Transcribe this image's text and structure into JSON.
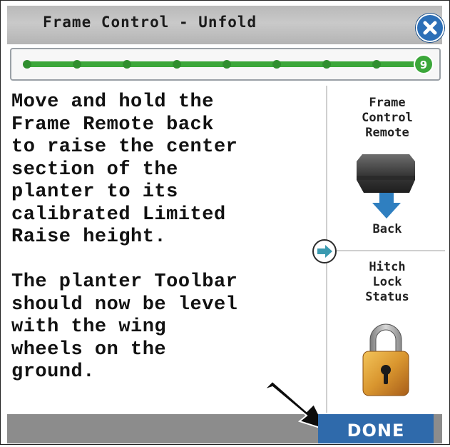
{
  "header": {
    "title": "Frame Control - Unfold"
  },
  "progress": {
    "total_steps": 9,
    "current_step": "9"
  },
  "instructions": {
    "text": "Move and hold the\nFrame Remote back\nto raise the center\nsection of the\nplanter to its\ncalibrated Limited\nRaise height.\n\nThe planter Toolbar\nshould now be level\nwith the wing\nwheels on the\nground."
  },
  "remote_panel": {
    "title": "Frame\nControl\nRemote",
    "direction_label": "Back"
  },
  "hitch_panel": {
    "title": "Hitch\nLock\nStatus",
    "status_icon": "padlock-locked-icon"
  },
  "footer": {
    "done_label": "DONE"
  },
  "colors": {
    "progress_green": "#3ca73a",
    "done_blue": "#2f6aab",
    "close_blue": "#2c6fb7",
    "arrow_teal": "#3a9ab0"
  }
}
